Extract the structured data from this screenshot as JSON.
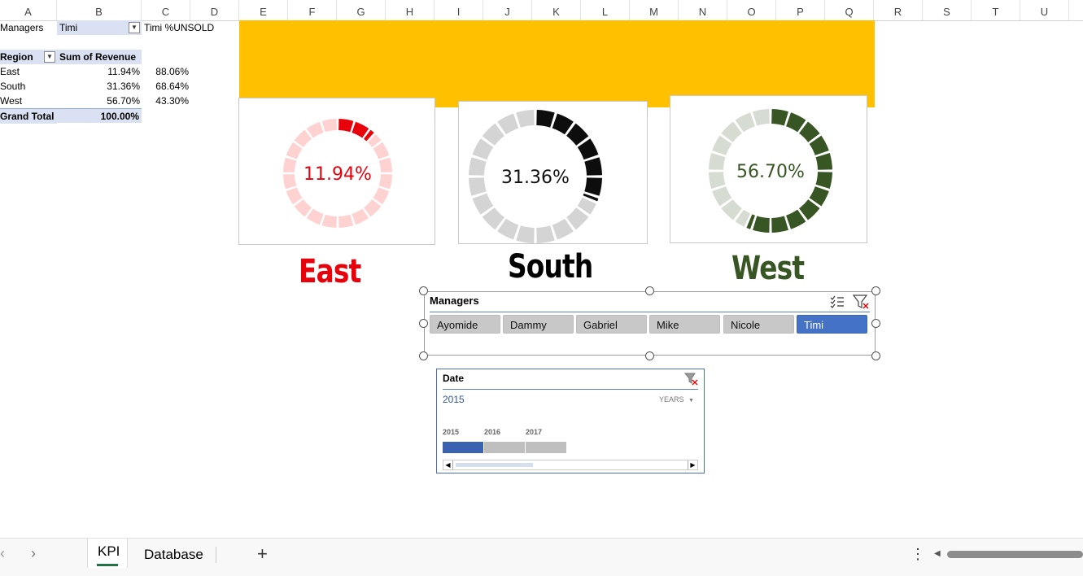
{
  "columns": [
    "A",
    "B",
    "C",
    "D",
    "E",
    "F",
    "G",
    "H",
    "I",
    "J",
    "K",
    "L",
    "M",
    "N",
    "O",
    "P",
    "Q",
    "R",
    "S",
    "T",
    "U"
  ],
  "pivot_filter": {
    "label": "Managers",
    "value": "Timi",
    "unsold_header": "Timi %UNSOLD"
  },
  "pivot": {
    "header_region": "Region",
    "header_value": "Sum of Revenue",
    "rows": [
      {
        "region": "East",
        "revenue": "11.94%",
        "unsold": "88.06%"
      },
      {
        "region": "South",
        "revenue": "31.36%",
        "unsold": "68.64%"
      },
      {
        "region": "West",
        "revenue": "56.70%",
        "unsold": "43.30%"
      }
    ],
    "grand_total_label": "Grand Total",
    "grand_total_value": "100.00%"
  },
  "kpis": [
    {
      "region": "East",
      "value_label": "11.94%",
      "percent": 11.94,
      "color": "#e8000b",
      "light": "#ffd2d2",
      "text_color": "#e8000b"
    },
    {
      "region": "South",
      "value_label": "31.36%",
      "percent": 31.36,
      "color": "#0d0d0d",
      "light": "#d4d4d4",
      "text_color": "#111111"
    },
    {
      "region": "West",
      "value_label": "56.70%",
      "percent": 56.7,
      "color": "#375623",
      "light": "#d6dcd2",
      "text_color": "#375623"
    }
  ],
  "slicer": {
    "title": "Managers",
    "items": [
      "Ayomide",
      "Dammy",
      "Gabriel",
      "Mike",
      "Nicole",
      "Timi"
    ],
    "selected": "Timi"
  },
  "timeline": {
    "title": "Date",
    "selection": "2015",
    "level": "YEARS",
    "years": [
      "2015",
      "2016",
      "2017"
    ],
    "selected_year": "2015"
  },
  "sheets": {
    "tabs": [
      "KPI",
      "Database"
    ],
    "active": "KPI"
  },
  "colors": {
    "banner": "#ffc000",
    "selected": "#4472c4",
    "excel_green": "#217346"
  }
}
